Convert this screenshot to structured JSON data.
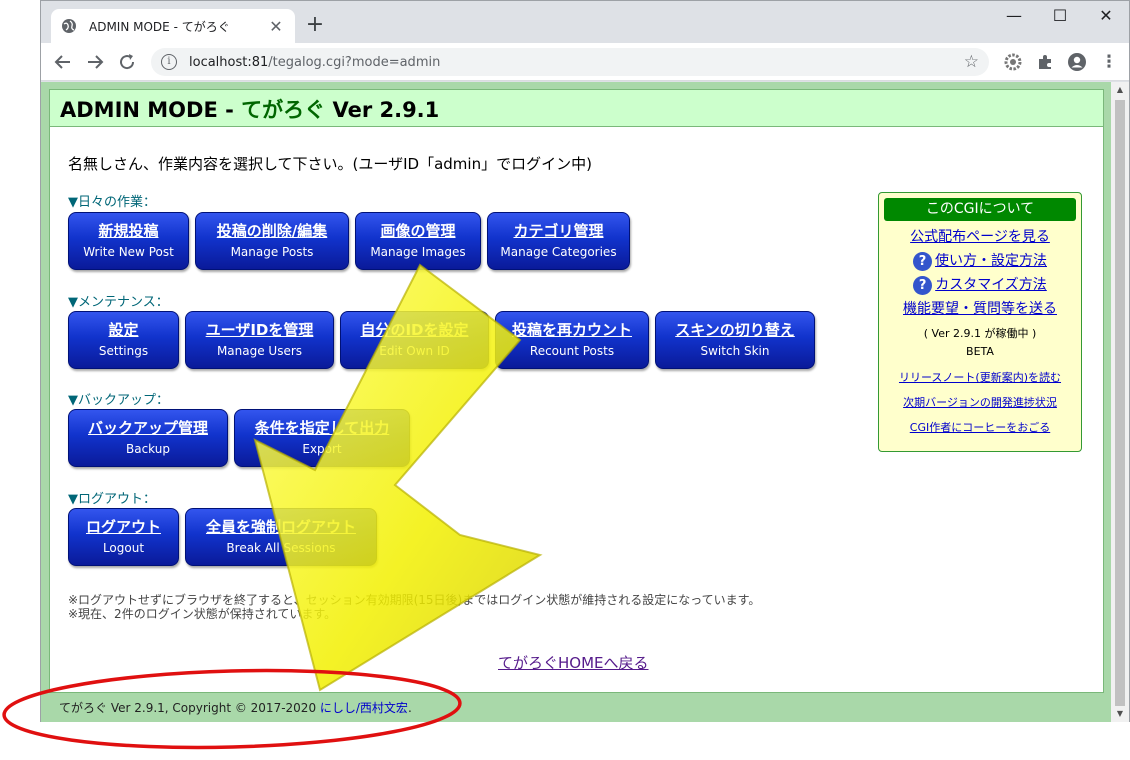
{
  "browser": {
    "tab_title": "ADMIN MODE - てがろぐ",
    "tab_close": "✕",
    "new_tab": "+",
    "url_host": "localhost:81",
    "url_path": "/tegalog.cgi?mode=admin",
    "win_min": "—",
    "win_max": "☐",
    "win_close": "✕"
  },
  "header": {
    "prefix": "ADMIN MODE - ",
    "app_name": "てがろぐ",
    "version": " Ver 2.9.1"
  },
  "greeting": "名無しさん、作業内容を選択して下さい。(ユーザID「admin」でログイン中)",
  "sections": {
    "daily": {
      "label": "▼日々の作業：",
      "buttons": [
        {
          "jp": "新規投稿",
          "en": "Write New Post"
        },
        {
          "jp": "投稿の削除/編集",
          "en": "Manage Posts"
        },
        {
          "jp": "画像の管理",
          "en": "Manage Images"
        },
        {
          "jp": "カテゴリ管理",
          "en": "Manage Categories"
        }
      ]
    },
    "maintenance": {
      "label": "▼メンテナンス：",
      "buttons": [
        {
          "jp": "設定",
          "en": "Settings"
        },
        {
          "jp": "ユーザIDを管理",
          "en": "Manage Users"
        },
        {
          "jp": "自分のIDを設定",
          "en": "Edit Own ID"
        },
        {
          "jp": "投稿を再カウント",
          "en": "Recount Posts"
        },
        {
          "jp": "スキンの切り替え",
          "en": "Switch Skin"
        }
      ]
    },
    "backup": {
      "label": "▼バックアップ：",
      "buttons": [
        {
          "jp": "バックアップ管理",
          "en": "Backup"
        },
        {
          "jp": "条件を指定して出力",
          "en": "Export"
        }
      ]
    },
    "logout": {
      "label": "▼ログアウト：",
      "buttons": [
        {
          "jp": "ログアウト",
          "en": "Logout"
        },
        {
          "jp": "全員を強制ログアウト",
          "en": "Break All Sessions"
        }
      ]
    }
  },
  "notes": {
    "line1": "※ログアウトせずにブラウザを終了すると、セッション有効期限(15日後)まではログイン状態が維持される設定になっています。",
    "line2": "※現在、2件のログイン状態が保持されています。"
  },
  "home_link": "てがろぐHOMEへ戻る",
  "footer": {
    "app_name": "てがろぐ",
    "copyright": " Ver 2.9.1, Copyright © 2017-2020 ",
    "author": "にしし/西村文宏",
    "period": "."
  },
  "about": {
    "title": "このCGIについて",
    "link_official": "公式配布ページを見る",
    "link_usage": "使い方・設定方法",
    "link_customize": "カスタマイズ方法",
    "link_request": "機能要望・質問等を送る",
    "running": "( Ver 2.9.1 が稼働中 )",
    "beta": "BETA",
    "link_release": "リリースノート(更新案内)を読む",
    "link_progress": "次期バージョンの開発進捗状況",
    "link_coffee": "CGI作者にコーヒーをおごる",
    "q_mark": "?"
  },
  "colors": {
    "accent_green": "#006600",
    "button_blue": "#1133cc",
    "annotation_arrow": "#f2f000",
    "annotation_ellipse": "#e01010"
  }
}
